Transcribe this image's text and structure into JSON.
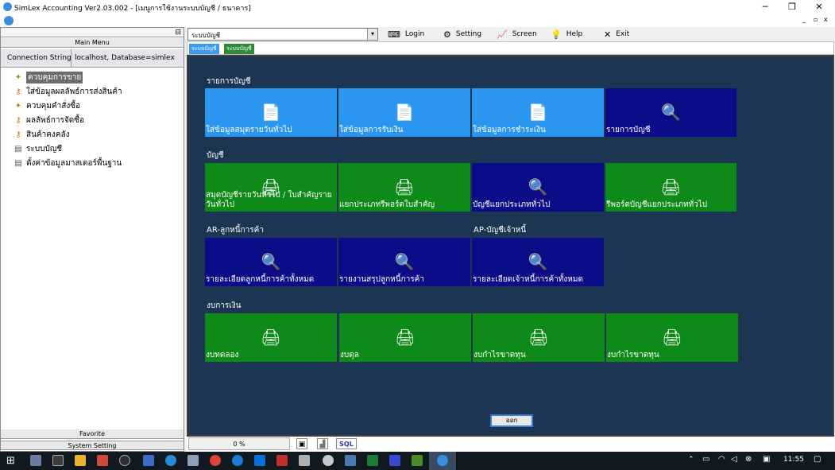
{
  "window": {
    "title": "SimLex Accounting Ver2.03.002 - [เมนูการใช้งานระบบบัญชี / ธนาคาร]"
  },
  "left": {
    "main_menu": "Main Menu",
    "conn_label": "Connection String",
    "conn_value": "localhost, Database=simlex",
    "items": [
      {
        "label": "ควบคุมการขาย"
      },
      {
        "label": "ใส่ข้อมูลผลลัพธ์การส่งสินค้า"
      },
      {
        "label": "ควบคุมคำสั่งซื้อ"
      },
      {
        "label": "ผลลัพธ์การจัดซื้อ"
      },
      {
        "label": "สินค้าคงคลัง"
      },
      {
        "label": "ระบบบัญชี"
      },
      {
        "label": "ตั้งค่าข้อมูลมาสเตอร์พื้นฐาน"
      }
    ],
    "favorite": "Favorite",
    "system_setting": "System Setting"
  },
  "toolbar": {
    "combo_value": "ระบบบัญชี",
    "login": "Login",
    "setting": "Setting",
    "screen": "Screen",
    "help": "Help",
    "exit": "Exit"
  },
  "tabs": [
    {
      "label": "ระบบบัญชี"
    },
    {
      "label": "ระบบบัญชี"
    }
  ],
  "sections": {
    "s1": "รายการบัญชี",
    "s2": "บัญชี",
    "s3a": "AR-ลูกหนี้การค้า",
    "s3b": "AP-บัญชีเจ้าหนี้",
    "s4": "งบการเงิน"
  },
  "tiles": {
    "t1": "ใส่ข้อมูลสมุดรายวันทั่วไป",
    "t2": "ใส่ข้อมูลการรับเงิน",
    "t3": "ใส่ข้อมูลการชำระเงิน",
    "t4": "รายการบัญชี",
    "t5": "สมุดบัญชีรายวันทั่วไป / ใบสำคัญรายวันทั่วไป",
    "t6": "แยกประเภทรีพอร์ตใบสำคัญ",
    "t7": "บัญชีแยกประเภททั่วไป",
    "t8": "รีพอร์ตบัญชีแยกประเภททั่วไป",
    "t9": "รายละเอียดลูกหนี้การค้าทั้งหมด",
    "t10": "รายงานสรุปลูกหนี้การค้า",
    "t11": "รายละเอียดเจ้าหนี้การค้าทั้งหมด",
    "t12": "งบทดลอง",
    "t13": "งบดุล",
    "t14": "งบกำไรขาดทุน",
    "t15": "งบกำไรขาดทุน"
  },
  "close_button": "ออก",
  "status": {
    "progress": "0 %",
    "sql": "SQL"
  },
  "taskbar": {
    "time": "11:55"
  },
  "colors": {
    "tile_blue": "#2a96f0",
    "tile_navy": "#0c0c88",
    "tile_green": "#0e8a18",
    "panel_bg": "#1c3552"
  }
}
